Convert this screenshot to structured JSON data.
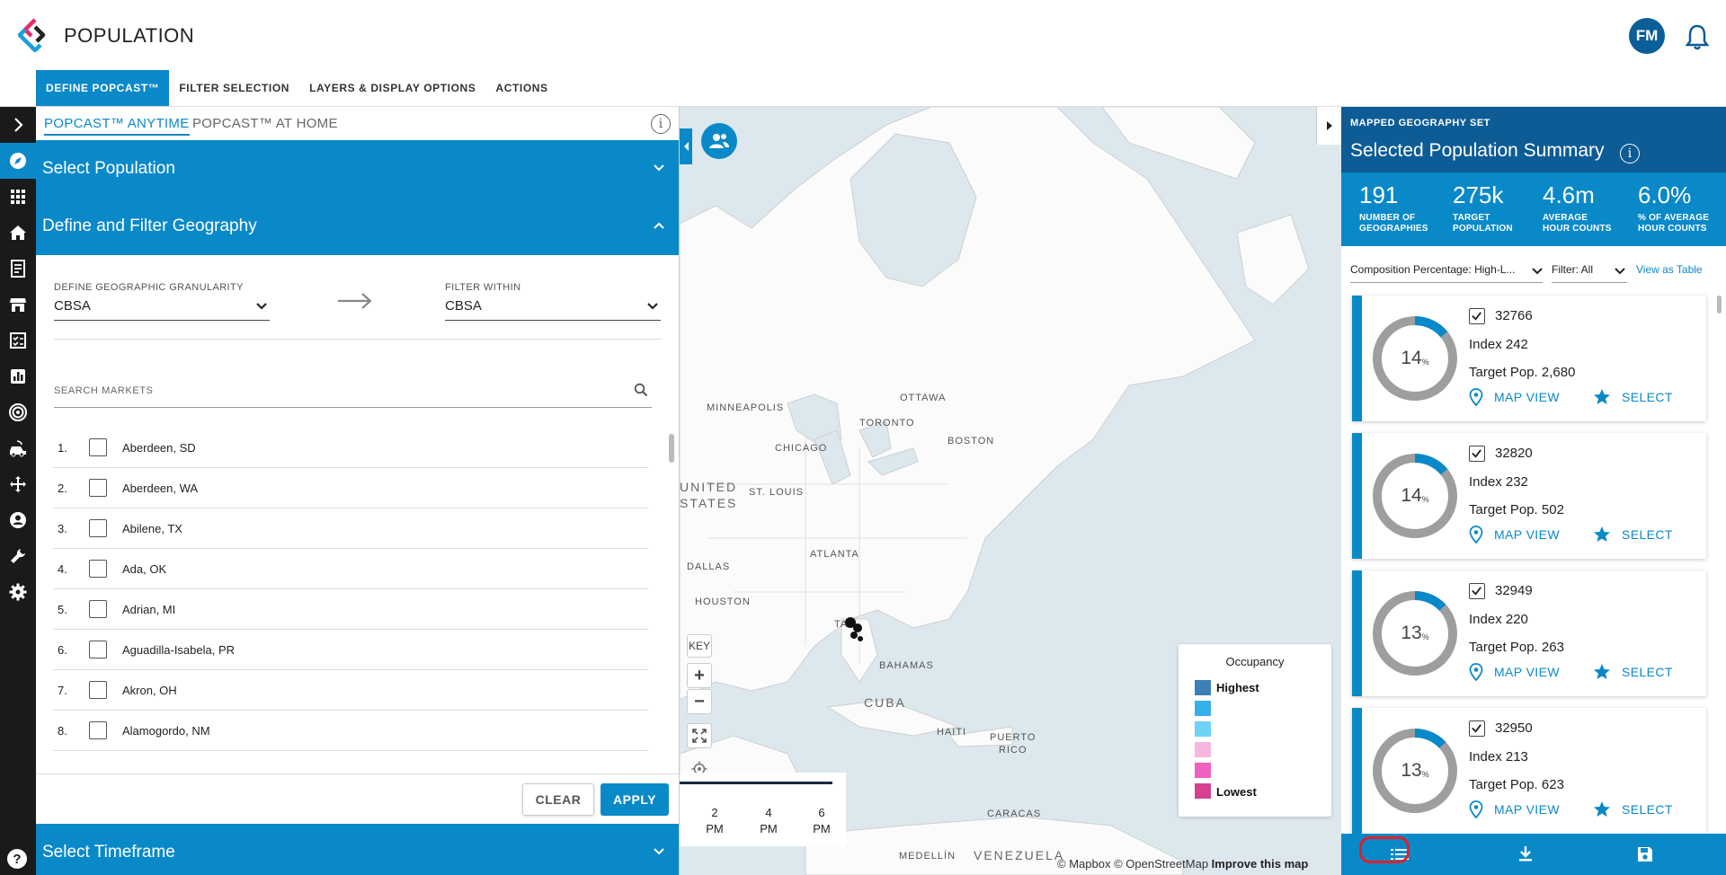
{
  "app": {
    "title": "POPULATION",
    "avatar_initials": "FM"
  },
  "tabs": [
    "DEFINE POPCAST™",
    "FILTER SELECTION",
    "LAYERS & DISPLAY OPTIONS",
    "ACTIONS"
  ],
  "rail_icons": [
    "chevron-right-icon",
    "compass-icon",
    "apps-grid-icon",
    "home-icon",
    "report-icon",
    "store-icon",
    "checklist-icon",
    "bar-chart-icon",
    "target-icon",
    "fleet-icon",
    "move-icon",
    "user-icon",
    "wrench-icon",
    "gear-icon",
    "help-icon"
  ],
  "subtabs": [
    "POPCAST™ ANYTIME",
    "POPCAST™ AT HOME"
  ],
  "accordions": {
    "select_population": "Select Population",
    "define_filter_geography": "Define and Filter Geography",
    "select_timeframe": "Select Timeframe"
  },
  "geography": {
    "granularity_label": "DEFINE GEOGRAPHIC GRANULARITY",
    "granularity_value": "CBSA",
    "filter_label": "FILTER WITHIN",
    "filter_value": "CBSA"
  },
  "search": {
    "placeholder": "SEARCH MARKETS"
  },
  "markets": [
    {
      "num": "1.",
      "name": "Aberdeen, SD"
    },
    {
      "num": "2.",
      "name": "Aberdeen, WA"
    },
    {
      "num": "3.",
      "name": "Abilene, TX"
    },
    {
      "num": "4.",
      "name": "Ada, OK"
    },
    {
      "num": "5.",
      "name": "Adrian, MI"
    },
    {
      "num": "6.",
      "name": "Aguadilla-Isabela, PR"
    },
    {
      "num": "7.",
      "name": "Akron, OH"
    },
    {
      "num": "8.",
      "name": "Alamogordo, NM"
    }
  ],
  "buttons": {
    "clear": "CLEAR",
    "apply": "APPLY"
  },
  "map": {
    "labels": [
      "MINNEAPOLIS",
      "OTTAWA",
      "TORONTO",
      "BOSTON",
      "CHICAGO",
      "ST. LOUIS",
      "ATLANTA",
      "DALLAS",
      "HOUSTON",
      "BAHAMAS",
      "CUBA",
      "HAITI",
      "PUERTO",
      "RICO",
      "CARACAS",
      "MEDELLÍN",
      "VENEZUELA",
      "UNITED",
      "STATES",
      "TA"
    ],
    "key_label": "KEY",
    "zoom_in": "+",
    "zoom_out": "−",
    "time_ticks": [
      {
        "hour": "2",
        "ampm": "PM"
      },
      {
        "hour": "4",
        "ampm": "PM"
      },
      {
        "hour": "6",
        "ampm": "PM"
      }
    ],
    "attribution": {
      "mapbox": "© Mapbox",
      "osm": "© OpenStreetMap",
      "improve": "Improve this map"
    }
  },
  "legend": {
    "title": "Occupancy",
    "highest": "Highest",
    "lowest": "Lowest",
    "colors": [
      "#3a7fb5",
      "#36b0e8",
      "#6fd3f7",
      "#f7b6e0",
      "#f060c0",
      "#d6408f"
    ]
  },
  "summary": {
    "subtitle": "MAPPED GEOGRAPHY SET",
    "title": "Selected Population Summary",
    "stats": [
      {
        "value": "191",
        "label1": "NUMBER OF",
        "label2": "GEOGRAPHIES"
      },
      {
        "value": "275k",
        "label1": "TARGET",
        "label2": "POPULATION"
      },
      {
        "value": "4.6m",
        "label1": "AVERAGE",
        "label2": "HOUR COUNTS"
      },
      {
        "value": "6.0%",
        "label1": "% OF AVERAGE",
        "label2": "HOUR COUNTS"
      }
    ],
    "composition": "Composition Percentage: High-L...",
    "filter": "Filter: All",
    "view_table": "View as Table"
  },
  "cards": [
    {
      "id": "32766",
      "pct": 14,
      "index": "Index 242",
      "pop": "Target Pop. 2,680"
    },
    {
      "id": "32820",
      "pct": 14,
      "index": "Index 232",
      "pop": "Target Pop. 502"
    },
    {
      "id": "32949",
      "pct": 13,
      "index": "Index 220",
      "pop": "Target Pop. 263"
    },
    {
      "id": "32950",
      "pct": 13,
      "index": "Index 213",
      "pop": "Target Pop. 623"
    }
  ],
  "card_actions": {
    "map_view": "MAP VIEW",
    "select": "SELECT",
    "pct_unit": "%"
  },
  "colors": {
    "accent": "#0a89c9",
    "dark_blue": "#0d5c96",
    "rail": "#1a1a1a"
  }
}
